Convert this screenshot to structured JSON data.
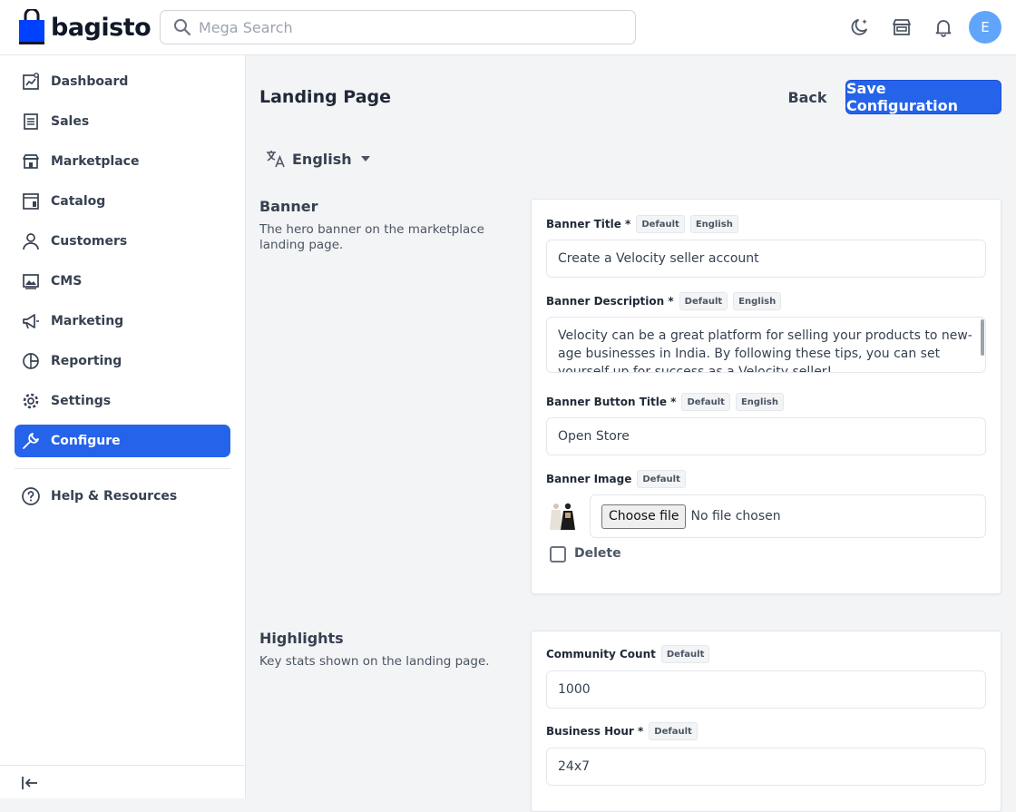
{
  "header": {
    "brand": "bagisto",
    "search_placeholder": "Mega Search",
    "avatar_initial": "E"
  },
  "sidebar": {
    "items": [
      {
        "label": "Dashboard",
        "icon": "dashboard-icon"
      },
      {
        "label": "Sales",
        "icon": "receipt-icon"
      },
      {
        "label": "Marketplace",
        "icon": "store-icon"
      },
      {
        "label": "Catalog",
        "icon": "catalog-icon"
      },
      {
        "label": "Customers",
        "icon": "user-icon"
      },
      {
        "label": "CMS",
        "icon": "image-icon"
      },
      {
        "label": "Marketing",
        "icon": "megaphone-icon"
      },
      {
        "label": "Reporting",
        "icon": "pie-chart-icon"
      },
      {
        "label": "Settings",
        "icon": "gear-icon"
      },
      {
        "label": "Configure",
        "icon": "wrench-icon",
        "active": true
      }
    ],
    "help_label": "Help & Resources"
  },
  "main": {
    "title": "Landing Page",
    "back_label": "Back",
    "save_label": "Save Configuration",
    "locale": "English",
    "banner": {
      "title": "Banner",
      "description": "The hero banner on the marketplace landing page.",
      "fields": {
        "title_label": "Banner Title *",
        "title_value": "Create a Velocity seller account",
        "desc_label": "Banner Description *",
        "desc_value": "Velocity can be a great platform for selling your products to new-age businesses in India. By following these tips, you can set yourself up for success as a Velocity seller!",
        "button_label": "Banner Button Title *",
        "button_value": "Open Store",
        "image_label": "Banner Image",
        "choose_file": "Choose file",
        "no_file": "No file chosen",
        "delete_label": "Delete"
      }
    },
    "highlights": {
      "title": "Highlights",
      "description": "Key stats shown on the landing page.",
      "fields": {
        "community_label": "Community Count",
        "community_value": "1000",
        "business_label": "Business Hour *",
        "business_value": "24x7"
      }
    },
    "badges": {
      "default": "Default",
      "english": "English"
    }
  },
  "colors": {
    "accent": "#2563eb",
    "avatar": "#60a5fa"
  }
}
